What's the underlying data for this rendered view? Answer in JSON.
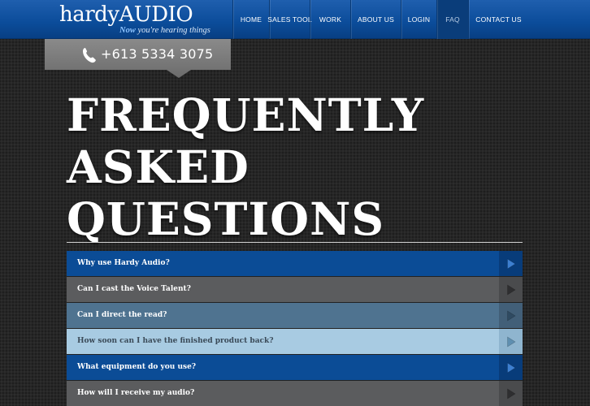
{
  "brand": {
    "logo_text_light": "hardy",
    "logo_text_bold": "AUDIO",
    "tagline_now": "Now",
    "tagline_rest": "you're hearing things"
  },
  "nav": {
    "items": [
      {
        "label": "HOME",
        "active": false
      },
      {
        "label": "SALES TOOL",
        "active": false
      },
      {
        "label": "WORK",
        "active": false
      },
      {
        "label": "ABOUT US",
        "active": false
      },
      {
        "label": "LOGIN",
        "active": false
      },
      {
        "label": "FAQ",
        "active": true
      },
      {
        "label": "CONTACT US",
        "active": false
      }
    ]
  },
  "contact": {
    "phone": "+613 5334 3075",
    "icon": "phone-icon"
  },
  "page": {
    "title_line1": "FREQUENTLY",
    "title_line2": "ASKED",
    "title_line3": "QUESTIONS"
  },
  "faq": {
    "items": [
      {
        "question": "Why use Hardy Audio?",
        "bg": "#0b4c96",
        "arrow_bg": "#083c7a",
        "arrow_color": "#3d7fd0",
        "text_color": "#ffffff"
      },
      {
        "question": "Can I cast the Voice Talent?",
        "bg": "#5b5c5e",
        "arrow_bg": "#4a4b4d",
        "arrow_color": "#2e2e30",
        "text_color": "#ffffff"
      },
      {
        "question": "Can I direct the read?",
        "bg": "#4f7390",
        "arrow_bg": "#425f78",
        "arrow_color": "#2f4a61",
        "text_color": "#ffffff"
      },
      {
        "question": "How soon can I have the finished product back?",
        "bg": "#a8cbe2",
        "arrow_bg": "#8fb5cf",
        "arrow_color": "#5f8fb0",
        "text_color": "#3a4a58"
      },
      {
        "question": "What equipment do you use?",
        "bg": "#0b4c96",
        "arrow_bg": "#083c7a",
        "arrow_color": "#3d7fd0",
        "text_color": "#ffffff"
      },
      {
        "question": "How will I receive my audio?",
        "bg": "#5b5c5e",
        "arrow_bg": "#4a4b4d",
        "arrow_color": "#2e2e30",
        "text_color": "#ffffff"
      }
    ]
  }
}
